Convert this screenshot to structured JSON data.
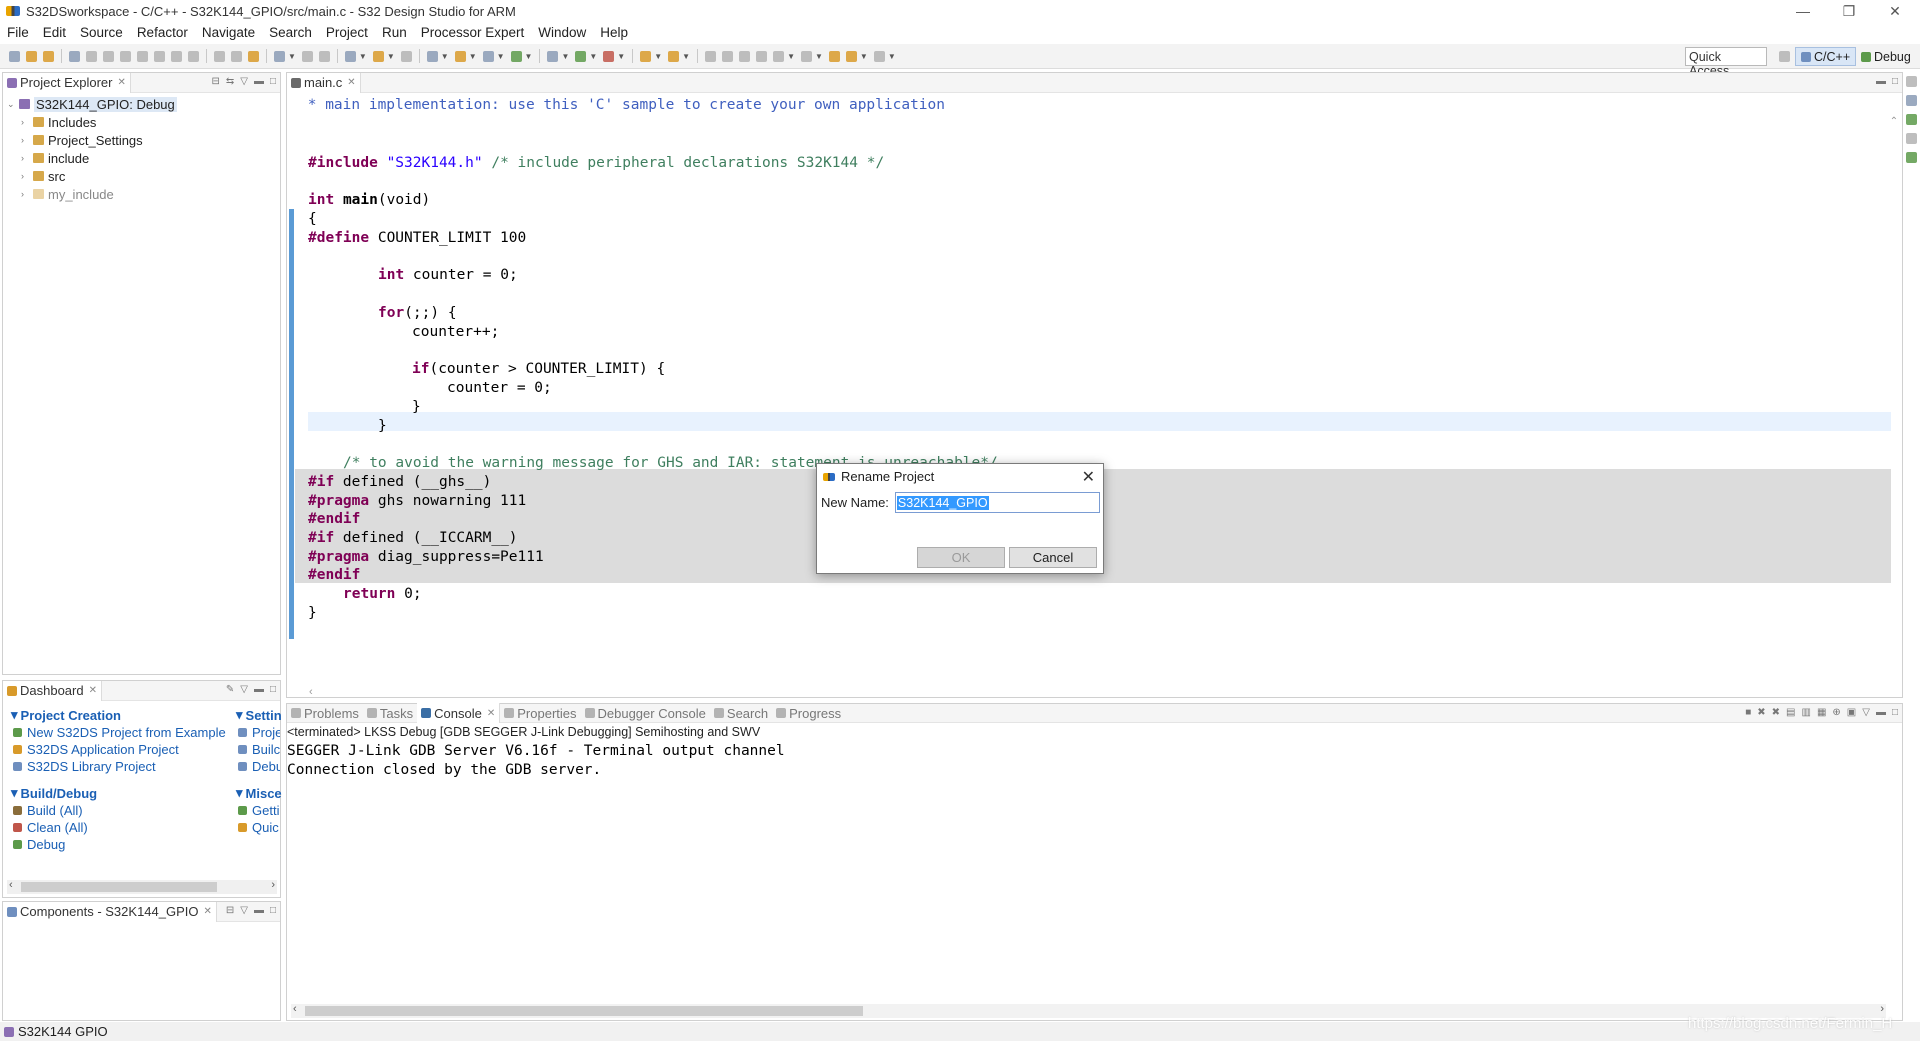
{
  "window": {
    "title": "S32DSworkspace - C/C++ - S32K144_GPIO/src/main.c - S32 Design Studio for ARM",
    "minimize": "—",
    "restore": "❐",
    "close": "✕"
  },
  "menu": [
    "File",
    "Edit",
    "Source",
    "Refactor",
    "Navigate",
    "Search",
    "Project",
    "Run",
    "Processor Expert",
    "Window",
    "Help"
  ],
  "toolbar": {
    "quick_access": "Quick Access",
    "perspectives": [
      "C/C++",
      "Debug"
    ]
  },
  "project_explorer": {
    "tab": "Project Explorer",
    "root": "S32K144_GPIO: Debug",
    "items": [
      "Includes",
      "Project_Settings",
      "include",
      "src",
      "my_include"
    ]
  },
  "editor": {
    "tab": "main.c",
    "lines": {
      "l1": " * main implementation: use this 'C' sample to create your own application",
      "include_kw": "#include",
      "include_str": "\"S32K144.h\"",
      "include_cm": "/* include peripheral declarations S32K144 */",
      "main_type": "int",
      "main_rest": "main",
      "main_args": "(void)",
      "brace_open": "{",
      "define_kw": "#define",
      "define_rest": " COUNTER_LIMIT 100",
      "int_kw": "int",
      "counter_decl": " counter = 0;",
      "for_kw": "for",
      "for_rest": "(;;) {",
      "counter_inc": "counter++;",
      "if_kw": "if",
      "if_rest": "(counter > COUNTER_LIMIT) {",
      "counter_reset": "counter = 0;",
      "inner_close": "}",
      "for_close": "}",
      "warn_comment": "/* to avoid the warning message for GHS and IAR: statement is unreachable*/",
      "if1_kw": "#if",
      "if1_rest": " defined (__ghs__)",
      "pragma1_kw": "#pragma",
      "pragma1_rest": " ghs nowarning 111",
      "endif1": "#endif",
      "if2_kw": "#if",
      "if2_rest": " defined (__ICCARM__)",
      "pragma2_kw": "#pragma",
      "pragma2_rest": " diag_suppress=Pe111",
      "endif2": "#endif",
      "return_kw": "return",
      "return_rest": " 0;",
      "brace_close": "}"
    }
  },
  "dashboard": {
    "tab": "Dashboard",
    "sections": {
      "project_creation": "Project Creation",
      "settings": "Settin",
      "build_debug": "Build/Debug",
      "misc": "Misce"
    },
    "project_items": [
      "New S32DS Project from Example",
      "S32DS Application Project",
      "S32DS Library Project"
    ],
    "settings_items": [
      "Proje",
      "Builc",
      "Debu"
    ],
    "build_items": [
      "Build  (All)",
      "Clean  (All)",
      "Debug"
    ],
    "misc_items": [
      "Getti",
      "Quic"
    ]
  },
  "components": {
    "tab": "Components - S32K144_GPIO"
  },
  "console": {
    "tabs": [
      "Problems",
      "Tasks",
      "Console",
      "Properties",
      "Debugger Console",
      "Search",
      "Progress"
    ],
    "active_tab": "Console",
    "header": "<terminated> LKSS Debug [GDB SEGGER J-Link Debugging] Semihosting and SWV",
    "lines": [
      "SEGGER J-Link GDB Server V6.16f - Terminal output channel",
      "Connection closed by the GDB server."
    ]
  },
  "status": {
    "selection": "S32K144 GPIO"
  },
  "watermark": "https://blog.csdn.net/Fermin_H",
  "dialog": {
    "title": "Rename Project",
    "label": "New Name:",
    "value": "S32K144_GPIO",
    "ok": "OK",
    "cancel": "Cancel"
  }
}
